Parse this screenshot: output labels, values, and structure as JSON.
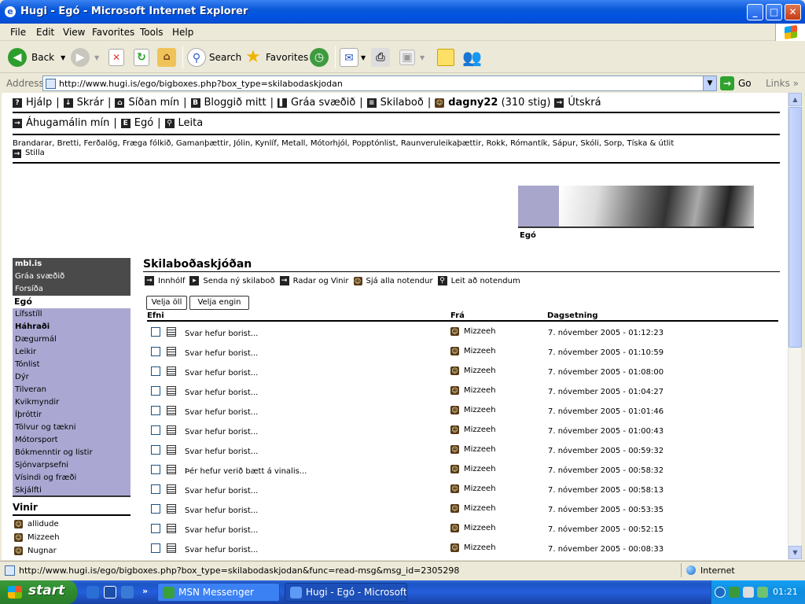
{
  "window": {
    "title": "Hugi - Egó - Microsoft Internet Explorer"
  },
  "menu": [
    "File",
    "Edit",
    "View",
    "Favorites",
    "Tools",
    "Help"
  ],
  "toolbar": {
    "back": "Back",
    "search": "Search",
    "favorites": "Favorites"
  },
  "address": {
    "label": "Address",
    "url": "http://www.hugi.is/ego/bigboxes.php?box_type=skilabodaskjodan",
    "go": "Go",
    "links": "Links"
  },
  "topnav": {
    "row1": [
      "Hjálp",
      "Skrár",
      "Síðan mín",
      "Bloggið mitt",
      "Gráa svæðið",
      "Skilaboð"
    ],
    "user": "dagny22",
    "points": "(310 stig)",
    "logout": "Útskrá",
    "row2": [
      "Áhugamálin mín",
      "Egó",
      "Leita"
    ]
  },
  "hobbies": "Brandarar, Bretti, Ferðalög, Fræga fólkið, Gamanþættir, Jólin, Kynlíf, Metall, Mótorhjól, Popptónlist, Raunveruleikaþættir, Rokk, Rómantík, Sápur, Skóli, Sorp, Tíska & útlit",
  "settings_label": "Stilla",
  "banner": {
    "label": "Egó"
  },
  "leftnav": {
    "dark": [
      "mbl.is",
      "Gráa svæðið",
      "Forsíða"
    ],
    "current": "Egó",
    "items": [
      "Lífsstíll",
      "Háhraði",
      "Dægurmál",
      "Leikir",
      "Tónlist",
      "Dýr",
      "Tilveran",
      "Kvikmyndir",
      "Íþróttir",
      "Tölvur og tækni",
      "Mótorsport",
      "Bókmenntir og listir",
      "Sjónvarpsefni",
      "Vísindi og fræði",
      "Skjálfti"
    ]
  },
  "vinir": {
    "title": "Vinir",
    "items": [
      "allidude",
      "Mizzeeh",
      "Nugnar"
    ]
  },
  "main": {
    "title": "Skilaboðaskjóðan",
    "subnav": [
      "Innhólf",
      "Senda ný skilaboð",
      "Radar og Vinir",
      "Sjá alla notendur",
      "Leit að notendum"
    ],
    "select_all": "Velja öll",
    "select_none": "Velja engin",
    "columns": {
      "subject": "Efni",
      "from": "Frá",
      "date": "Dagsetning"
    },
    "messages": [
      {
        "subject": "Svar hefur borist...",
        "from": "Mizzeeh",
        "date": "7. nóvember 2005 - 01:12:23"
      },
      {
        "subject": "Svar hefur borist...",
        "from": "Mizzeeh",
        "date": "7. nóvember 2005 - 01:10:59"
      },
      {
        "subject": "Svar hefur borist...",
        "from": "Mizzeeh",
        "date": "7. nóvember 2005 - 01:08:00"
      },
      {
        "subject": "Svar hefur borist...",
        "from": "Mizzeeh",
        "date": "7. nóvember 2005 - 01:04:27"
      },
      {
        "subject": "Svar hefur borist...",
        "from": "Mizzeeh",
        "date": "7. nóvember 2005 - 01:01:46"
      },
      {
        "subject": "Svar hefur borist...",
        "from": "Mizzeeh",
        "date": "7. nóvember 2005 - 01:00:43"
      },
      {
        "subject": "Svar hefur borist...",
        "from": "Mizzeeh",
        "date": "7. nóvember 2005 - 00:59:32"
      },
      {
        "subject": "Þér hefur verið bætt á vinalis...",
        "from": "Mizzeeh",
        "date": "7. nóvember 2005 - 00:58:32"
      },
      {
        "subject": "Svar hefur borist...",
        "from": "Mizzeeh",
        "date": "7. nóvember 2005 - 00:58:13"
      },
      {
        "subject": "Svar hefur borist...",
        "from": "Mizzeeh",
        "date": "7. nóvember 2005 - 00:53:35"
      },
      {
        "subject": "Svar hefur borist...",
        "from": "Mizzeeh",
        "date": "7. nóvember 2005 - 00:52:15"
      },
      {
        "subject": "Svar hefur borist...",
        "from": "Mizzeeh",
        "date": "7. nóvember 2005 - 00:08:33"
      }
    ]
  },
  "status": {
    "text": "http://www.hugi.is/ego/bigboxes.php?box_type=skilabodaskjodan&func=read-msg&msg_id=2305298",
    "zone": "Internet"
  },
  "taskbar": {
    "start": "start",
    "tasks": [
      "MSN Messenger",
      "Hugi - Egó - Microsoft..."
    ],
    "clock": "01:21"
  },
  "icons": {
    "nav": "arrow-right-icon",
    "smiley": "smiley-icon",
    "doc": "document-icon"
  }
}
